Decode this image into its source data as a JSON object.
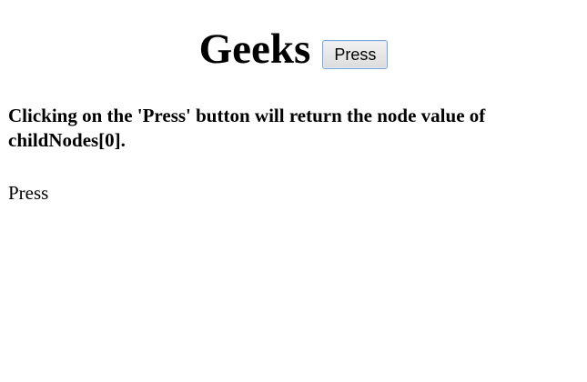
{
  "header": {
    "title": "Geeks",
    "button_label": "Press"
  },
  "instruction": "Clicking on the 'Press' button will return the node value of childNodes[0].",
  "output_text": "Press"
}
